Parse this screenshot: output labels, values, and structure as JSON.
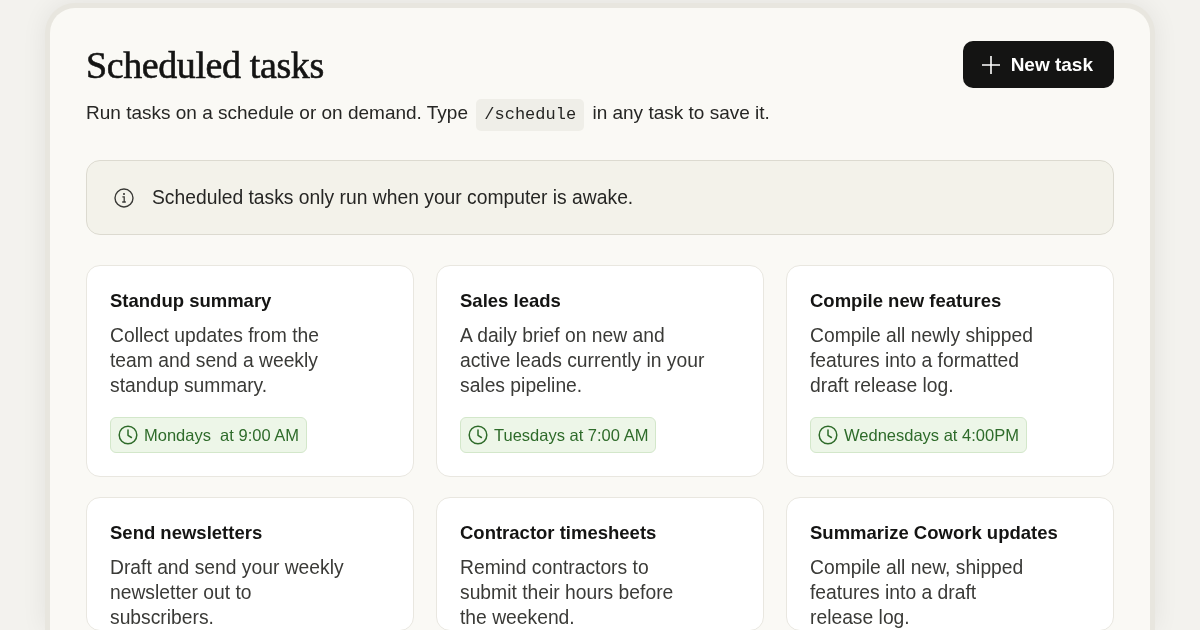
{
  "header": {
    "title": "Scheduled tasks",
    "new_task_button": {
      "label": "New task"
    }
  },
  "subtitle": {
    "before": "Run tasks on a schedule or on demand. Type",
    "code": "/schedule",
    "after": "in any task to save it."
  },
  "notice": {
    "text": "Scheduled tasks only run when your computer is awake."
  },
  "tasks": [
    {
      "title": "Standup summary",
      "description": "Collect updates from the\nteam and send a weekly\nstandup summary.",
      "schedule": "Mondays  at 9:00 AM"
    },
    {
      "title": "Sales leads",
      "description": "A daily brief on new and\nactive leads currently in your\nsales pipeline.",
      "schedule": "Tuesdays at 7:00 AM"
    },
    {
      "title": "Compile new features",
      "description": "Compile all newly shipped\nfeatures into a formatted\ndraft release log.",
      "schedule": "Wednesdays at 4:00PM"
    },
    {
      "title": "Send newsletters",
      "description": "Draft and send your weekly\nnewsletter out to\nsubscribers."
    },
    {
      "title": "Contractor timesheets",
      "description": "Remind contractors to\nsubmit their hours before\nthe weekend."
    },
    {
      "title": "Summarize Cowork updates",
      "description": "Compile all new, shipped\nfeatures into a draft\nrelease log."
    }
  ]
}
